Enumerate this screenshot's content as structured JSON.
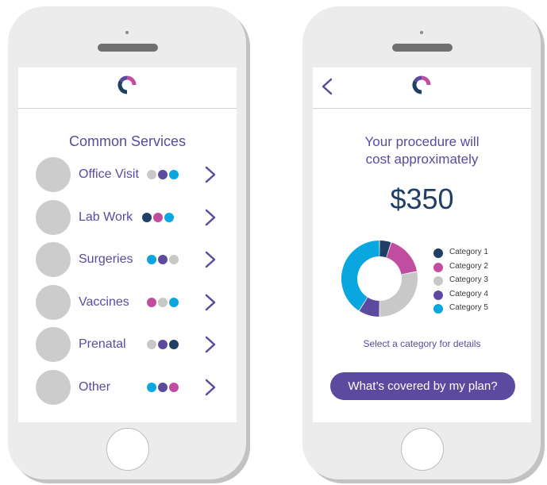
{
  "colors": {
    "navy": "#1f3f64",
    "magenta": "#c04da0",
    "gray": "#c8c8c8",
    "purple": "#5b4a9f",
    "cyan": "#0aa6e0"
  },
  "left_screen": {
    "title": "Common Services",
    "services": [
      {
        "label": "Office Visit",
        "dots": [
          "gray",
          "purple",
          "cyan"
        ]
      },
      {
        "label": "Lab Work",
        "dots": [
          "navy",
          "magenta",
          "cyan"
        ]
      },
      {
        "label": "Surgeries",
        "dots": [
          "cyan",
          "purple",
          "gray"
        ]
      },
      {
        "label": "Vaccines",
        "dots": [
          "magenta",
          "gray",
          "cyan"
        ]
      },
      {
        "label": "Prenatal",
        "dots": [
          "gray",
          "purple",
          "navy"
        ]
      },
      {
        "label": "Other",
        "dots": [
          "cyan",
          "purple",
          "magenta"
        ]
      }
    ]
  },
  "right_screen": {
    "headline_line1": "Your procedure will",
    "headline_line2": "cost approximately",
    "price": "$350",
    "legend": [
      {
        "label": "Category 1",
        "color": "navy"
      },
      {
        "label": "Category 2",
        "color": "magenta"
      },
      {
        "label": "Category 3",
        "color": "gray"
      },
      {
        "label": "Category 4",
        "color": "purple"
      },
      {
        "label": "Category 5",
        "color": "cyan"
      }
    ],
    "donut_shares": [
      {
        "color": "navy",
        "fraction": 0.05
      },
      {
        "color": "magenta",
        "fraction": 0.17
      },
      {
        "color": "gray",
        "fraction": 0.28
      },
      {
        "color": "purple",
        "fraction": 0.09
      },
      {
        "color": "cyan",
        "fraction": 0.41
      }
    ],
    "hint": "Select a category for details",
    "cta_label": "What’s covered by my plan?"
  }
}
